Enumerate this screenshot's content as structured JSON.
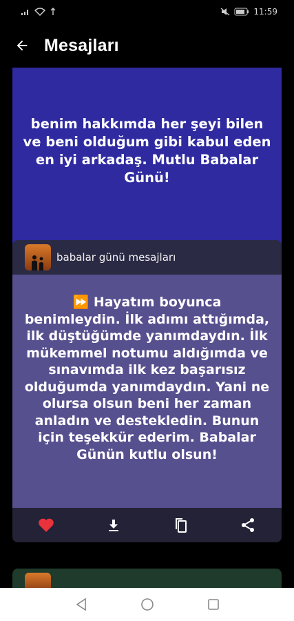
{
  "status": {
    "time": "11:59"
  },
  "appbar": {
    "title": "Mesajları"
  },
  "cards": [
    {
      "message": "benim hakkımda her şeyi bilen ve beni olduğum gibi kabul eden en iyi arkadaş. Mutlu Babalar Günü!"
    },
    {
      "category": "babalar günü mesajları",
      "message": "⏩ Hayatım boyunca benimleydin. İlk adımı attığımda, ilk düştüğümde yanımdaydın. İlk mükemmel notumu aldığımda ve sınavımda ilk kez başarısız olduğumda yanımdaydın. Yani ne olursa olsun beni her zaman anladın ve destekledin. Bunun için teşekkür ederim. Babalar Günün kutlu olsun!"
    }
  ],
  "icons": {
    "favorite": "heart-icon",
    "download": "download-icon",
    "copy": "copy-icon",
    "share": "share-icon"
  },
  "colors": {
    "heart": "#e8323c",
    "card1_body": "#2f2aa0",
    "card2_body": "#57508f"
  }
}
